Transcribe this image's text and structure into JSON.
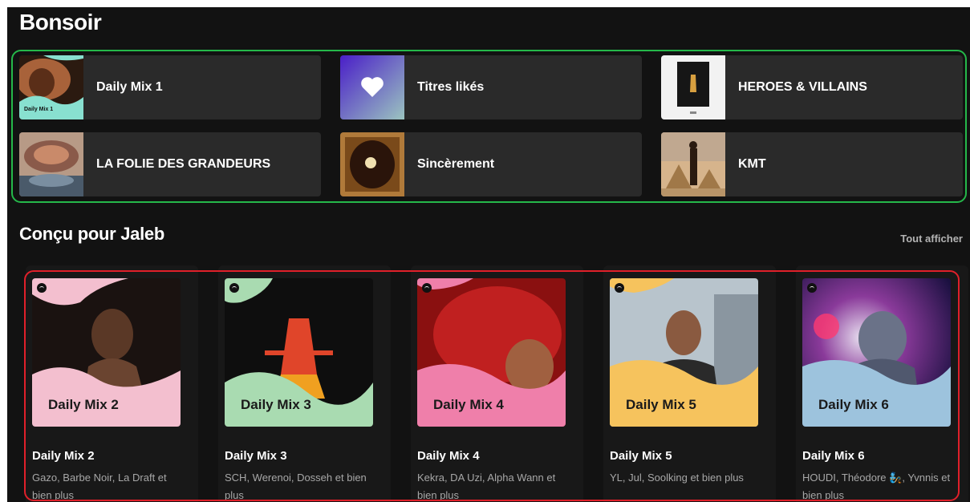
{
  "home": {
    "greeting": "Bonsoir",
    "shortcuts": [
      {
        "title": "Daily Mix 1",
        "cover_text": "Daily Mix 1"
      },
      {
        "title": "Titres likés"
      },
      {
        "title": "HEROES & VILLAINS"
      },
      {
        "title": "LA FOLIE DES GRANDEURS"
      },
      {
        "title": "Sincèrement"
      },
      {
        "title": "KMT"
      }
    ]
  },
  "made_for": {
    "title": "Conçu pour Jaleb",
    "show_all": "Tout afficher",
    "cards": [
      {
        "title": "Daily Mix 2",
        "cover_text": "Daily Mix 2",
        "subtitle": "Gazo, Barbe Noir, La Draft et bien plus",
        "accent": "#f3bfcf"
      },
      {
        "title": "Daily Mix 3",
        "cover_text": "Daily Mix 3",
        "subtitle": "SCH, Werenoi, Dosseh et bien plus",
        "accent": "#a9dbb1"
      },
      {
        "title": "Daily Mix 4",
        "cover_text": "Daily Mix 4",
        "subtitle": "Kekra, DA Uzi, Alpha Wann et bien plus",
        "accent": "#ef7faa"
      },
      {
        "title": "Daily Mix 5",
        "cover_text": "Daily Mix 5",
        "subtitle": "YL, Jul, Soolking et bien plus",
        "accent": "#f6c35d"
      },
      {
        "title": "Daily Mix 6",
        "cover_text": "Daily Mix 6",
        "subtitle": "HOUDI, Théodore 🧞, Yvnnis et bien plus",
        "accent": "#9dc3dd"
      }
    ]
  },
  "colors": {
    "background": "#121212",
    "tile": "#2a2a2a",
    "card": "#181818",
    "shortcut_highlight": "#25b84a",
    "cards_highlight": "#e0202a"
  }
}
